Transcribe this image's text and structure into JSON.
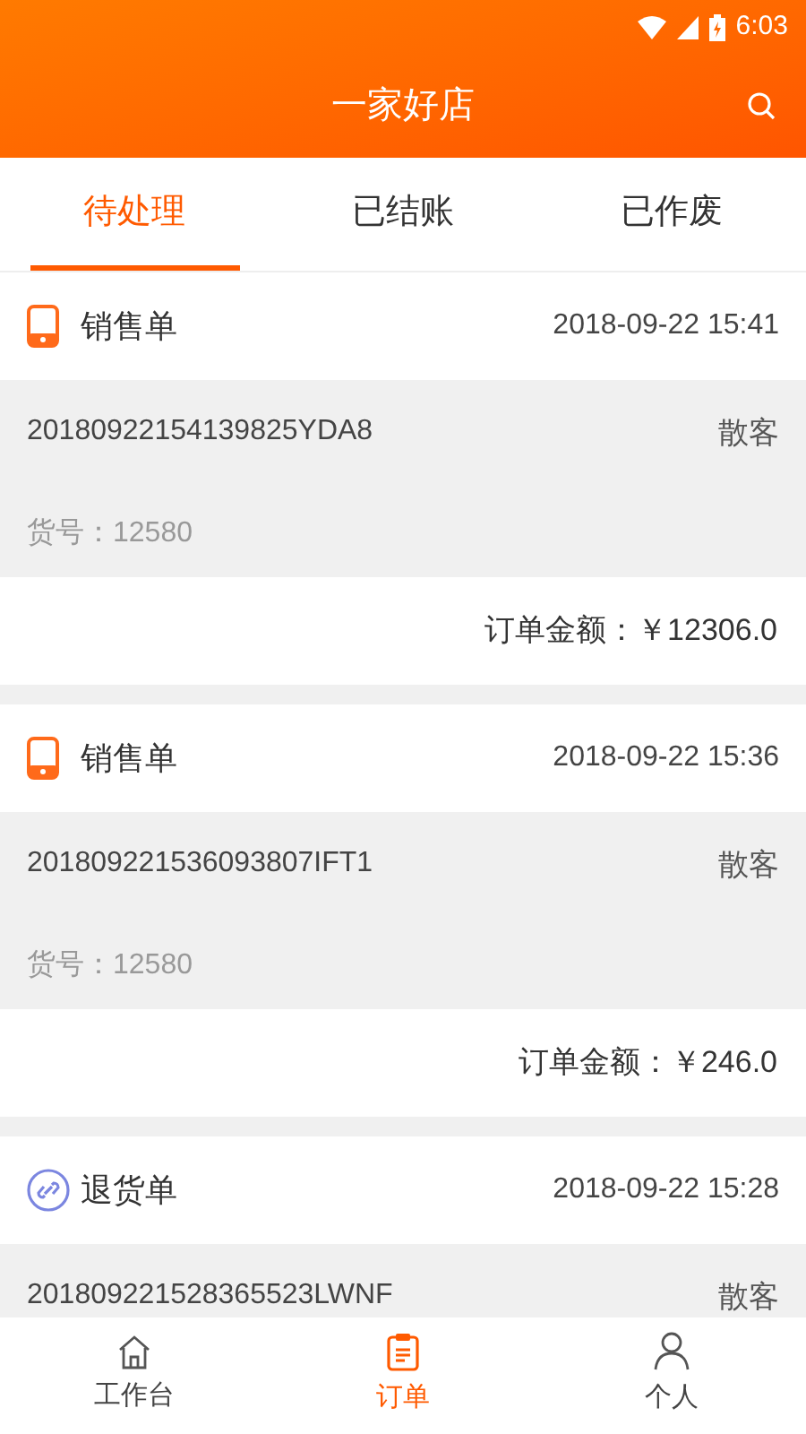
{
  "status_bar": {
    "time": "6:03"
  },
  "header": {
    "title": "一家好店"
  },
  "tabs": [
    {
      "label": "待处理",
      "selected": true
    },
    {
      "label": "已结账",
      "selected": false
    },
    {
      "label": "已作废",
      "selected": false
    }
  ],
  "orders": [
    {
      "kind": "sale",
      "type_label": "销售单",
      "time": "2018-09-22 15:41",
      "order_no": "20180922154139825YDA8",
      "customer": "散客",
      "item_no": "货号：12580",
      "amount": "订单金额：￥12306.0"
    },
    {
      "kind": "sale",
      "type_label": "销售单",
      "time": "2018-09-22 15:36",
      "order_no": "201809221536093807IFT1",
      "customer": "散客",
      "item_no": "货号：12580",
      "amount": "订单金额：￥246.0"
    },
    {
      "kind": "return",
      "type_label": "退货单",
      "time": "2018-09-22 15:28",
      "order_no": "201809221528365523LWNF",
      "customer": "散客"
    }
  ],
  "bottom_nav": [
    {
      "label": "工作台",
      "kind": "home",
      "selected": false
    },
    {
      "label": "订单",
      "kind": "orders",
      "selected": true
    },
    {
      "label": "个人",
      "kind": "profile",
      "selected": false
    }
  ]
}
